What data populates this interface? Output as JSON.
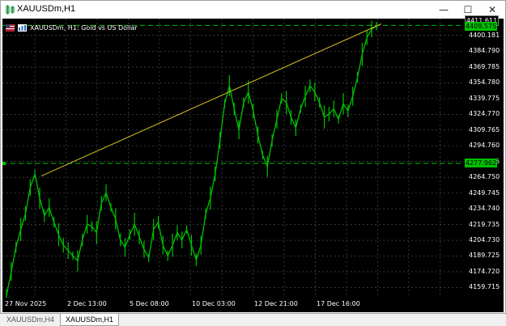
{
  "window": {
    "title": "XAUUSDm,H1",
    "controls": {
      "minimize": "—",
      "maximize": "☐",
      "close": "✕"
    }
  },
  "chart": {
    "header": "XAUUSDm, H1:  Gold vs US Dollar",
    "ask_badge": "4411.611",
    "bid_badge": "4409.575",
    "hline_badge": "4277.962",
    "colors": {
      "background": "#000000",
      "candles": "#00c000",
      "trendline": "#d4c020",
      "grid": "#5a5a5a"
    }
  },
  "chart_data": {
    "type": "line",
    "yticks": [
      "4400.181",
      "4384.790",
      "4369.785",
      "4354.780",
      "4339.775",
      "4324.770",
      "4309.765",
      "4294.760",
      "4279.755",
      "4264.750",
      "4249.745",
      "4234.740",
      "4219.735",
      "4204.730",
      "4189.725",
      "4174.720",
      "4159.715"
    ],
    "xticks": [
      "27 Nov 2025",
      "2 Dec 13:00",
      "5 Dec 08:00",
      "10 Dec 03:00",
      "12 Dec 21:00",
      "17 Dec 16:00"
    ],
    "horizontal_line": 4277.962,
    "current_price": 4409.575,
    "trendline": {
      "start": 4266.0,
      "end": 4411.0
    },
    "series": [
      {
        "values": [
          4152,
          4175,
          4198,
          4215,
          4230,
          4255,
          4268,
          4245,
          4228,
          4236,
          4222,
          4210,
          4200,
          4195,
          4190,
          4185,
          4205,
          4220,
          4218,
          4212,
          4240,
          4250,
          4236,
          4225,
          4205,
          4198,
          4210,
          4220,
          4208,
          4196,
          4188,
          4215,
          4222,
          4200,
          4190,
          4200,
          4212,
          4205,
          4215,
          4200,
          4186,
          4200,
          4230,
          4245,
          4268,
          4300,
          4335,
          4352,
          4330,
          4310,
          4336,
          4346,
          4328,
          4305,
          4286,
          4275,
          4300,
          4320,
          4340,
          4336,
          4322,
          4312,
          4330,
          4342,
          4352,
          4346,
          4336,
          4322,
          4325,
          4330,
          4320,
          4335,
          4328,
          4342,
          4360,
          4382,
          4398,
          4406,
          4409
        ]
      }
    ]
  },
  "tabs": [
    {
      "label": "XAUUSDm,H4",
      "active": false
    },
    {
      "label": "XAUUSDm,H1",
      "active": true
    }
  ]
}
